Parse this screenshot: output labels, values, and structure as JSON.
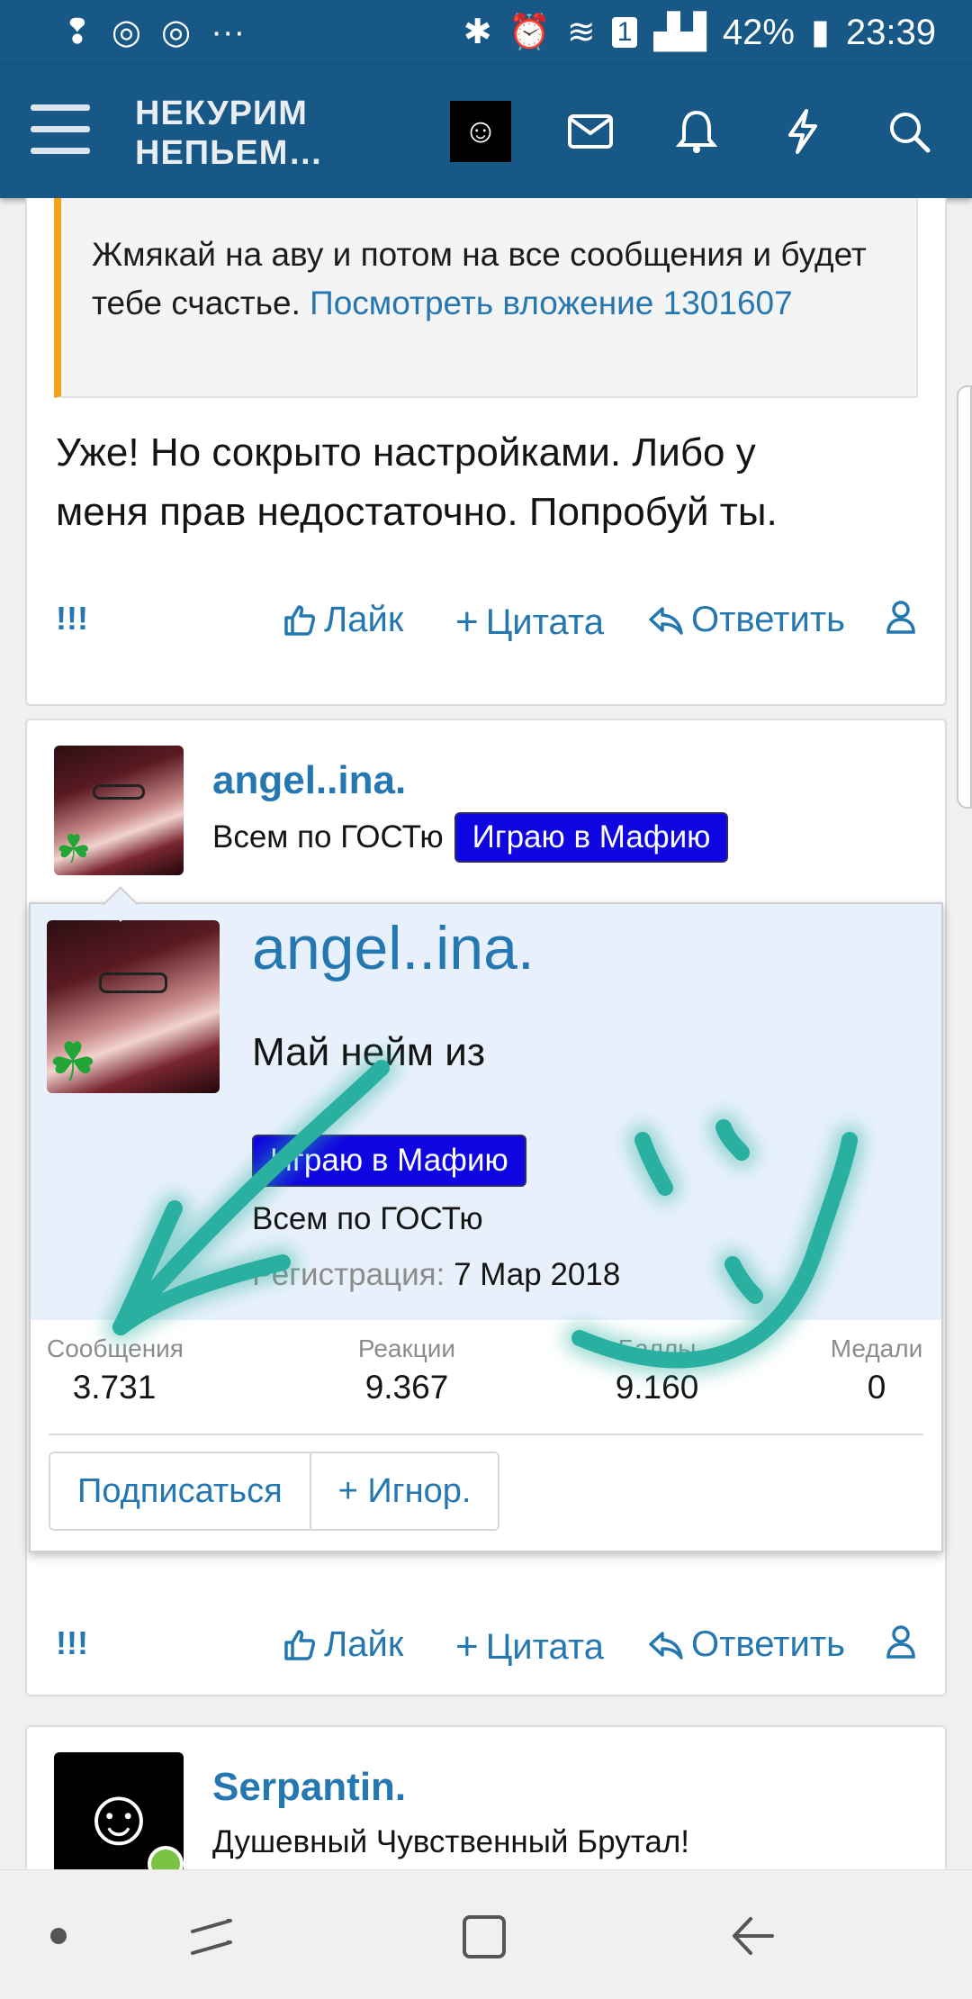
{
  "status_bar": {
    "left_icons": [
      "notification-icon",
      "instagram-icon",
      "instagram-icon",
      "more-dots-icon"
    ],
    "battery": "42%",
    "time": "23:39",
    "sim_label": "1"
  },
  "header": {
    "logo_line1": "НЕКУРИМ",
    "logo_line2": "НЕПЬЕМ…",
    "icons": [
      "menu-icon",
      "site-avatar",
      "mail-icon",
      "bell-icon",
      "lightning-icon",
      "search-icon"
    ]
  },
  "post1": {
    "quote_text": "Жмякай на аву и потом на все сообщения и будет тебе счастье.",
    "quote_link": "Посмотреть вложение 1301607",
    "message_line1": "Уже! Но сокрыто настройками. Либо у",
    "message_line2": "меня прав недостаточно. Попробуй ты.",
    "actions": {
      "bang": "!!!",
      "like": "Лайк",
      "quote": "Цитата",
      "reply": "Ответить"
    }
  },
  "post2": {
    "username": "angel..ina.",
    "title": "Всем по ГОСТю",
    "badge": "Играю в Мафию",
    "actions": {
      "bang": "!!!",
      "like": "Лайк",
      "quote": "Цитата",
      "reply": "Ответить"
    }
  },
  "popup": {
    "username": "angel..ina.",
    "status": "Май нейм из",
    "badge": "Играю в Мафию",
    "title": "Всем по ГОСТю",
    "reg_label": "Регистрация:",
    "reg_date": "7 Мар 2018",
    "stats": [
      {
        "label": "Сообщения",
        "value": "3.731"
      },
      {
        "label": "Реакции",
        "value": "9.367"
      },
      {
        "label": "Баллы",
        "value": "9.160"
      },
      {
        "label": "Медали",
        "value": "0"
      }
    ],
    "subscribe": "Подписаться",
    "ignore": "+ Игнор."
  },
  "post3": {
    "username": "Serpantin.",
    "title": "Душевный Чувственный Брутал!"
  },
  "colors": {
    "brand": "#185886",
    "link": "#2577b1",
    "badge": "#0f05e0",
    "drawing": "#2ab0a0"
  }
}
